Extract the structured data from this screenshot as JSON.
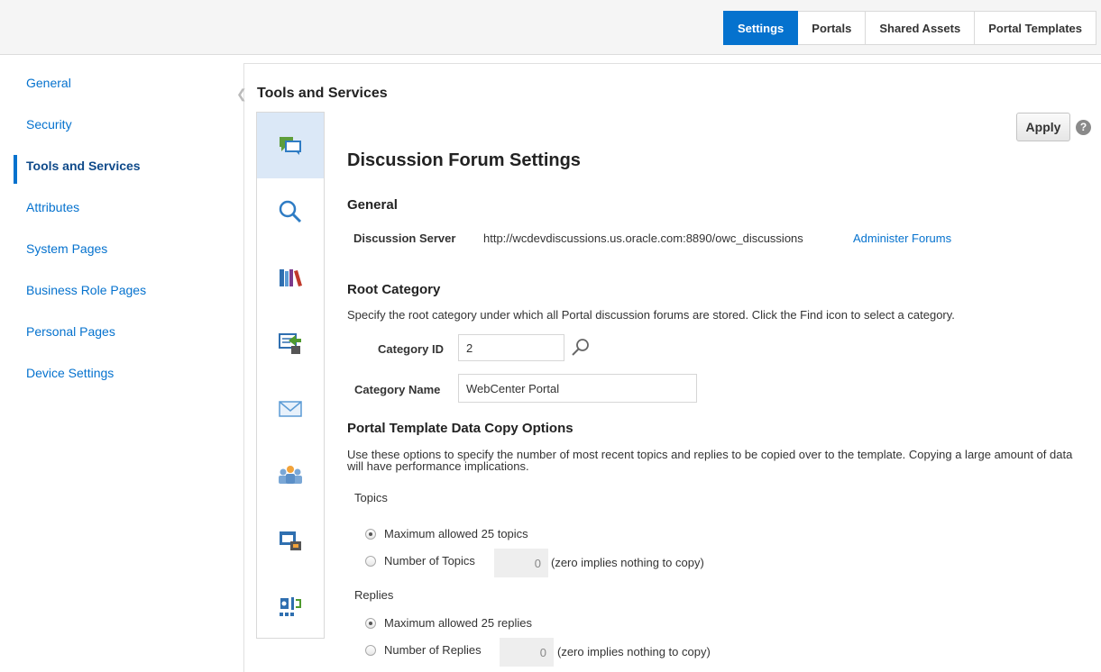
{
  "top_tabs": [
    {
      "label": "Settings"
    },
    {
      "label": "Portals"
    },
    {
      "label": "Shared Assets"
    },
    {
      "label": "Portal Templates"
    }
  ],
  "sidebar": {
    "items": [
      {
        "label": "General"
      },
      {
        "label": "Security"
      },
      {
        "label": "Tools and Services"
      },
      {
        "label": "Attributes"
      },
      {
        "label": "System Pages"
      },
      {
        "label": "Business Role Pages"
      },
      {
        "label": "Personal Pages"
      },
      {
        "label": "Device Settings"
      }
    ],
    "active_index": 2
  },
  "panel": {
    "title": "Tools and Services"
  },
  "icon_strip": {
    "icons": [
      "discussions-icon",
      "search-icon",
      "library-icon",
      "documents-icon",
      "mail-icon",
      "people-icon",
      "events-icon",
      "integration-icon"
    ],
    "selected_index": 0
  },
  "actions": {
    "apply_label": "Apply",
    "help_symbol": "?"
  },
  "form": {
    "title": "Discussion Forum Settings",
    "general": {
      "heading": "General",
      "server_label": "Discussion Server",
      "server_url": "http://wcdevdiscussions.us.oracle.com:8890/owc_discussions",
      "administer_link": "Administer Forums"
    },
    "root_category": {
      "heading": "Root Category",
      "description": "Specify the root category under which all Portal discussion forums are stored. Click the Find icon to select a category.",
      "category_id_label": "Category ID",
      "category_id_value": "2",
      "category_name_label": "Category Name",
      "category_name_value": "WebCenter Portal"
    },
    "copy_options": {
      "heading": "Portal Template Data Copy Options",
      "description": "Use these options to specify the number of most recent topics and replies to be copied over to the template. Copying a large amount of data will have performance implications.",
      "topics_label": "Topics",
      "topics_max_label": "Maximum allowed 25 topics",
      "topics_number_label": "Number of Topics",
      "topics_number_value": "0",
      "topics_hint": "(zero implies nothing to copy)",
      "replies_label": "Replies",
      "replies_max_label": "Maximum allowed 25 replies",
      "replies_number_label": "Number of Replies",
      "replies_number_value": "0",
      "replies_hint": "(zero implies nothing to copy)"
    }
  },
  "colors": {
    "accent": "#0572ce",
    "selected_bg": "#dbe8f7"
  }
}
